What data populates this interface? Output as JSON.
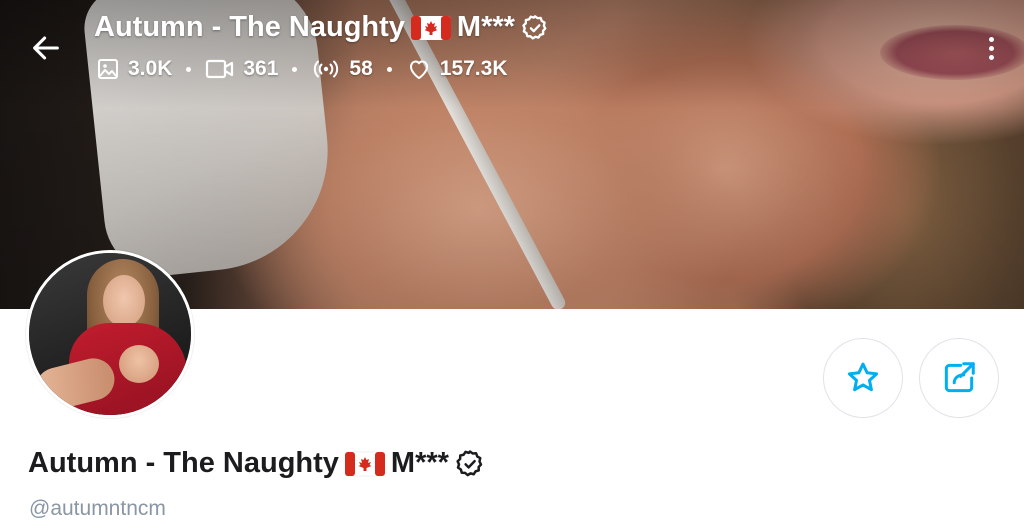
{
  "header": {
    "title_prefix": "Autumn - The Naughty",
    "title_suffix": "M***",
    "stats": {
      "photos": "3.0K",
      "videos": "361",
      "streams": "58",
      "likes": "157.3K"
    }
  },
  "profile": {
    "name_prefix": "Autumn - The Naughty",
    "name_suffix": "M***",
    "handle": "@autumntncm"
  },
  "icons": {
    "back": "arrow-left-icon",
    "more": "kebab-menu-icon",
    "verified": "verified-badge-icon",
    "flag": "canada-flag-icon",
    "photos": "image-icon",
    "videos": "video-icon",
    "streams": "broadcast-icon",
    "likes": "heart-icon",
    "favorite": "star-icon",
    "share": "share-icon"
  },
  "colors": {
    "accent": "#00aff0",
    "text_dark": "#1c1c1e",
    "text_muted": "#8a96a3"
  }
}
